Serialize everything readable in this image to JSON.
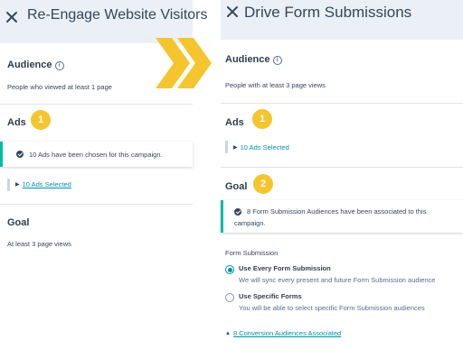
{
  "colors": {
    "accent_yellow": "#f5c52f",
    "alert_bar": "#00bda5",
    "link": "#0091ae",
    "header_bg": "#eaf0f6",
    "text": "#2d3e50"
  },
  "left": {
    "title": "Re-Engage Website Visitors",
    "audience": {
      "heading": "Audience",
      "text": "People who viewed at least 1 page"
    },
    "ads": {
      "heading": "Ads",
      "badge": "1",
      "alert": "10 Ads have been chosen for this campaign.",
      "link": "10 Ads Selected"
    },
    "goal": {
      "heading": "Goal",
      "text": "At least 3 page views"
    }
  },
  "right": {
    "title": "Drive Form Submissions",
    "audience": {
      "heading": "Audience",
      "text": "People with at least 3 page views"
    },
    "ads": {
      "heading": "Ads",
      "badge": "1",
      "link": "10 Ads Selected"
    },
    "goal": {
      "heading": "Goal",
      "badge": "2",
      "alert_line1": "8 Form Submission Audiences have been associated to this",
      "alert_line2": "campaign.",
      "form_label": "Form Submission",
      "option1_title": "Use Every Form Submission",
      "option1_desc": "We will sync every present and future Form Submission audience",
      "option2_title": "Use Specific Forms",
      "option2_desc": "You will be able to select specific Form Submission audiences",
      "link": "8 Conversion Audiences Associated"
    }
  }
}
